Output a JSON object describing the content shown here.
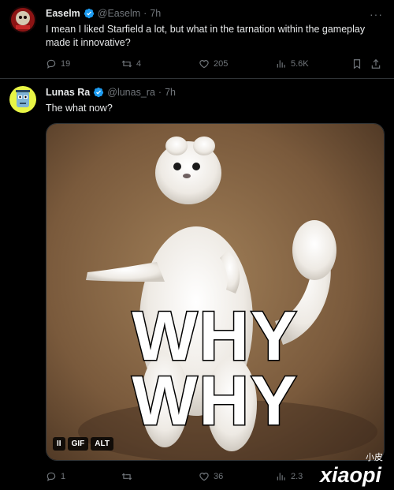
{
  "tweets": [
    {
      "name": "Easelm",
      "handle": "@Easelm",
      "time": "7h",
      "text": "I mean I liked Starfield a lot, but what in the tarnation within the gameplay made it innovative?",
      "stats": {
        "replies": "19",
        "reposts": "4",
        "likes": "205",
        "views": "5.6K"
      }
    },
    {
      "name": "Lunas Ra",
      "handle": "@lunas_ra",
      "time": "7h",
      "text": "The what now?",
      "media": {
        "caption_line1": "WHY",
        "caption_line2": "WHY",
        "pause_label": "II",
        "gif_label": "GIF",
        "alt_label": "ALT"
      },
      "stats": {
        "replies": "1",
        "reposts": "",
        "likes": "36",
        "views": "2.3"
      }
    }
  ],
  "separator": "·",
  "more_label": "···",
  "watermark": {
    "top": "小皮",
    "bottom": "xiaopi"
  },
  "colors": {
    "background": "#000000",
    "verified": "#1d9bf0",
    "muted": "#71767b",
    "text": "#e7e9ea"
  },
  "icons": [
    "verified-badge-icon",
    "reply-icon",
    "repost-icon",
    "like-icon",
    "views-icon",
    "bookmark-icon",
    "share-icon",
    "more-icon"
  ]
}
